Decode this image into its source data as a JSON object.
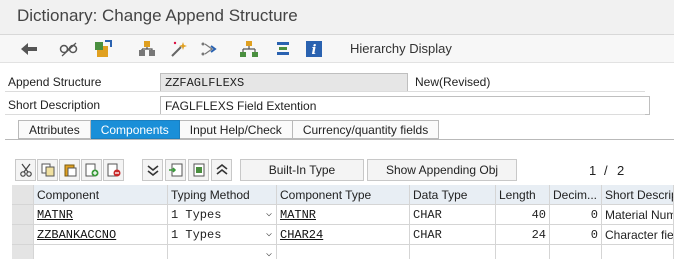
{
  "window": {
    "title": "Dictionary: Change Append Structure"
  },
  "toolbar": {
    "hierarchy_label": "Hierarchy Display"
  },
  "form": {
    "append_label": "Append Structure",
    "append_value": "ZZFAGLFLEXS",
    "status": "New(Revised)",
    "desc_label": "Short Description",
    "desc_value": "FAGLFLEXS Field Extention"
  },
  "tabs": [
    "Attributes",
    "Components",
    "Input Help/Check",
    "Currency/quantity fields"
  ],
  "active_tab": "Components",
  "grid_toolbar": {
    "builtin_label": "Built-In Type",
    "show_append_label": "Show Appending Obj",
    "page": "1",
    "page_sep": "/",
    "page_total": "2"
  },
  "columns": [
    "Component",
    "Typing Method",
    "Component Type",
    "Data Type",
    "Length",
    "Decim...",
    "Short Descrip"
  ],
  "rows": [
    {
      "component": "MATNR",
      "typing": "1 Types",
      "comp_type": "MATNR",
      "data_type": "CHAR",
      "length": "40",
      "decimals": "0",
      "short_desc": "Material Numb"
    },
    {
      "component": "ZZBANKACCNO",
      "typing": "1 Types",
      "comp_type": "CHAR24",
      "data_type": "CHAR",
      "length": "24",
      "decimals": "0",
      "short_desc": "Character field"
    },
    {
      "component": "",
      "typing": "",
      "comp_type": "",
      "data_type": "",
      "length": "",
      "decimals": "",
      "short_desc": ""
    }
  ]
}
